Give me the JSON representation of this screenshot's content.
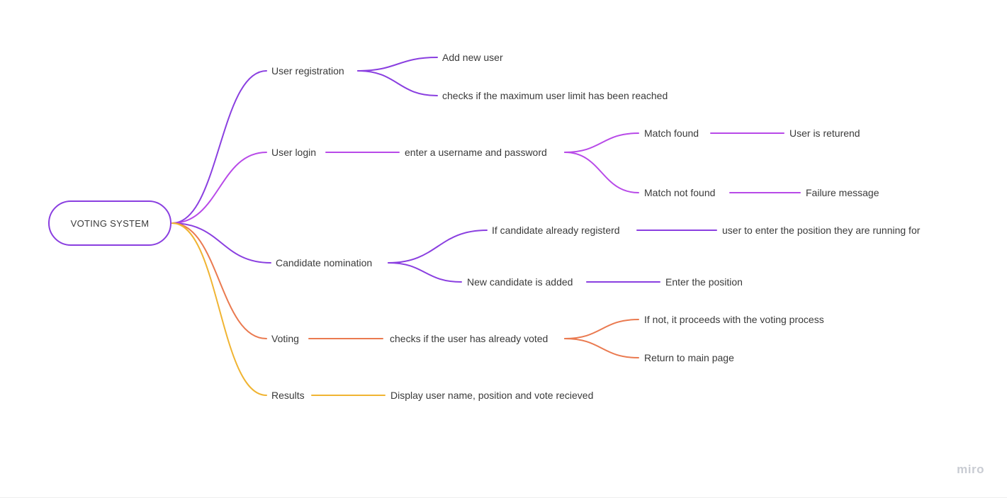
{
  "colors": {
    "purple": "#8a3fe0",
    "violet": "#b84ae8",
    "orange": "#ea7a50",
    "yellow": "#f0b432",
    "text": "#3a3a3a"
  },
  "root": {
    "label": "VOTING SYSTEM"
  },
  "branches": [
    {
      "label": "User registration",
      "children": [
        {
          "label": "Add new user"
        },
        {
          "label": "checks if the maximum user limit has been reached"
        }
      ]
    },
    {
      "label": "User login",
      "children": [
        {
          "label": "enter a username and password",
          "children": [
            {
              "label": "Match found",
              "children": [
                {
                  "label": "User is returend"
                }
              ]
            },
            {
              "label": "Match not found",
              "children": [
                {
                  "label": "Failure message"
                }
              ]
            }
          ]
        }
      ]
    },
    {
      "label": "Candidate nomination",
      "children": [
        {
          "label": "If candidate already registerd",
          "children": [
            {
              "label": "user to enter the position they are running for"
            }
          ]
        },
        {
          "label": "New candidate is added",
          "children": [
            {
              "label": "Enter the position"
            }
          ]
        }
      ]
    },
    {
      "label": "Voting",
      "children": [
        {
          "label": "checks if the user has already voted",
          "children": [
            {
              "label": "If not, it proceeds with the voting process"
            },
            {
              "label": "Return to main page"
            }
          ]
        }
      ]
    },
    {
      "label": "Results",
      "children": [
        {
          "label": "Display user name, position and vote recieved"
        }
      ]
    }
  ],
  "brand": "miro"
}
